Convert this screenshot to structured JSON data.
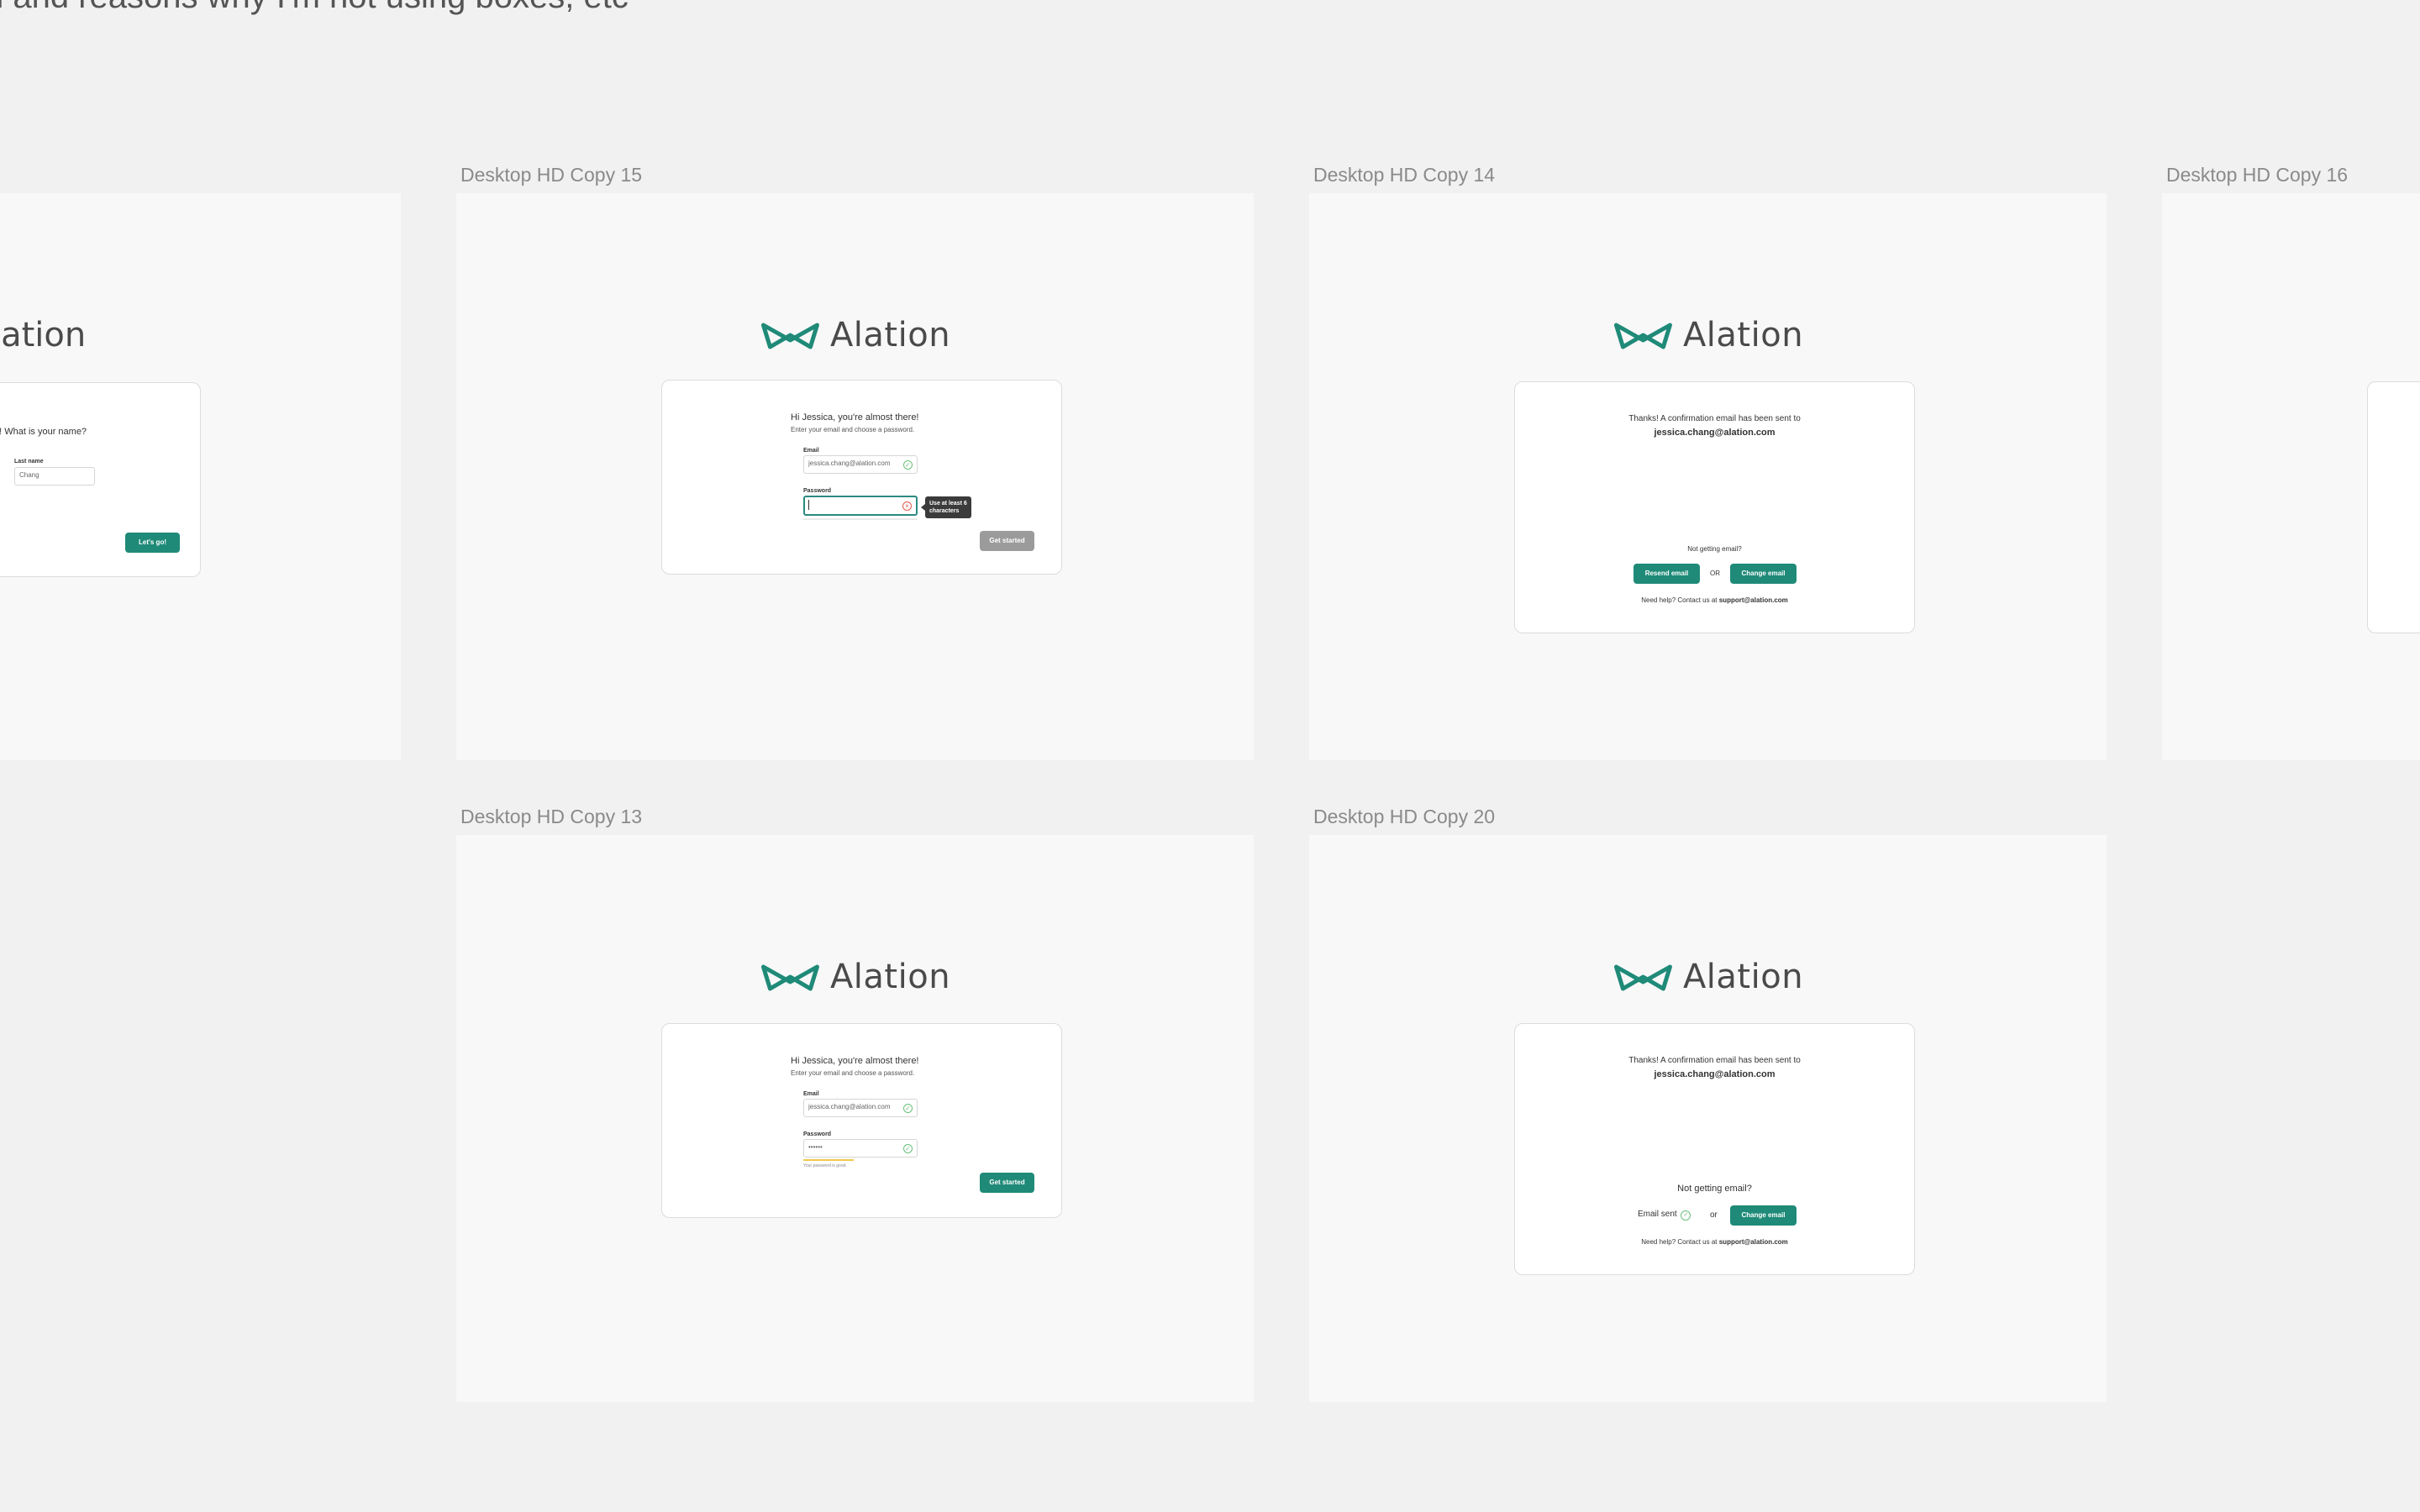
{
  "canvas_note": "n and reasons why I'm not using boxes, etc",
  "brand": {
    "name": "Alation",
    "color": "#1f8a78"
  },
  "artboards": {
    "left": {
      "logo_word": "lation",
      "question": "n! What is your name?",
      "last_name_label": "Last name",
      "last_name_value": "Chang",
      "button": "Let's go!"
    },
    "copy15": {
      "label": "Desktop HD Copy 15",
      "greeting": "Hi Jessica, you're almost there!",
      "subtitle": "Enter your email and choose a password.",
      "email_label": "Email",
      "email_value": "jessica.chang@alation.com",
      "password_label": "Password",
      "password_value": "",
      "tooltip_line1": "Use at least 6",
      "tooltip_line2": "characters",
      "button": "Get started"
    },
    "copy14": {
      "label": "Desktop HD Copy 14",
      "thanks": "Thanks! A confirmation email has been sent to",
      "email": "jessica.chang@alation.com",
      "not_getting": "Not getting email?",
      "resend": "Resend email",
      "or": "OR",
      "change": "Change email",
      "help_prefix": "Need help? Contact us at ",
      "help_email": "support@alation.com"
    },
    "copy16": {
      "label": "Desktop HD Copy 16"
    },
    "copy13": {
      "label": "Desktop HD Copy 13",
      "greeting": "Hi Jessica, you're almost there!",
      "subtitle": "Enter your email and choose a password.",
      "email_label": "Email",
      "email_value": "jessica.chang@alation.com",
      "password_label": "Password",
      "password_value": "••••••",
      "hint": "Your password is good.",
      "button": "Get started"
    },
    "copy20": {
      "label": "Desktop HD Copy 20",
      "thanks": "Thanks! A confirmation email has been sent to",
      "email": "jessica.chang@alation.com",
      "not_getting": "Not getting email?",
      "sent": "Email sent",
      "or": "or",
      "change": "Change email",
      "help_prefix": "Need help? Contact us at ",
      "help_email": "support@alation.com"
    }
  }
}
